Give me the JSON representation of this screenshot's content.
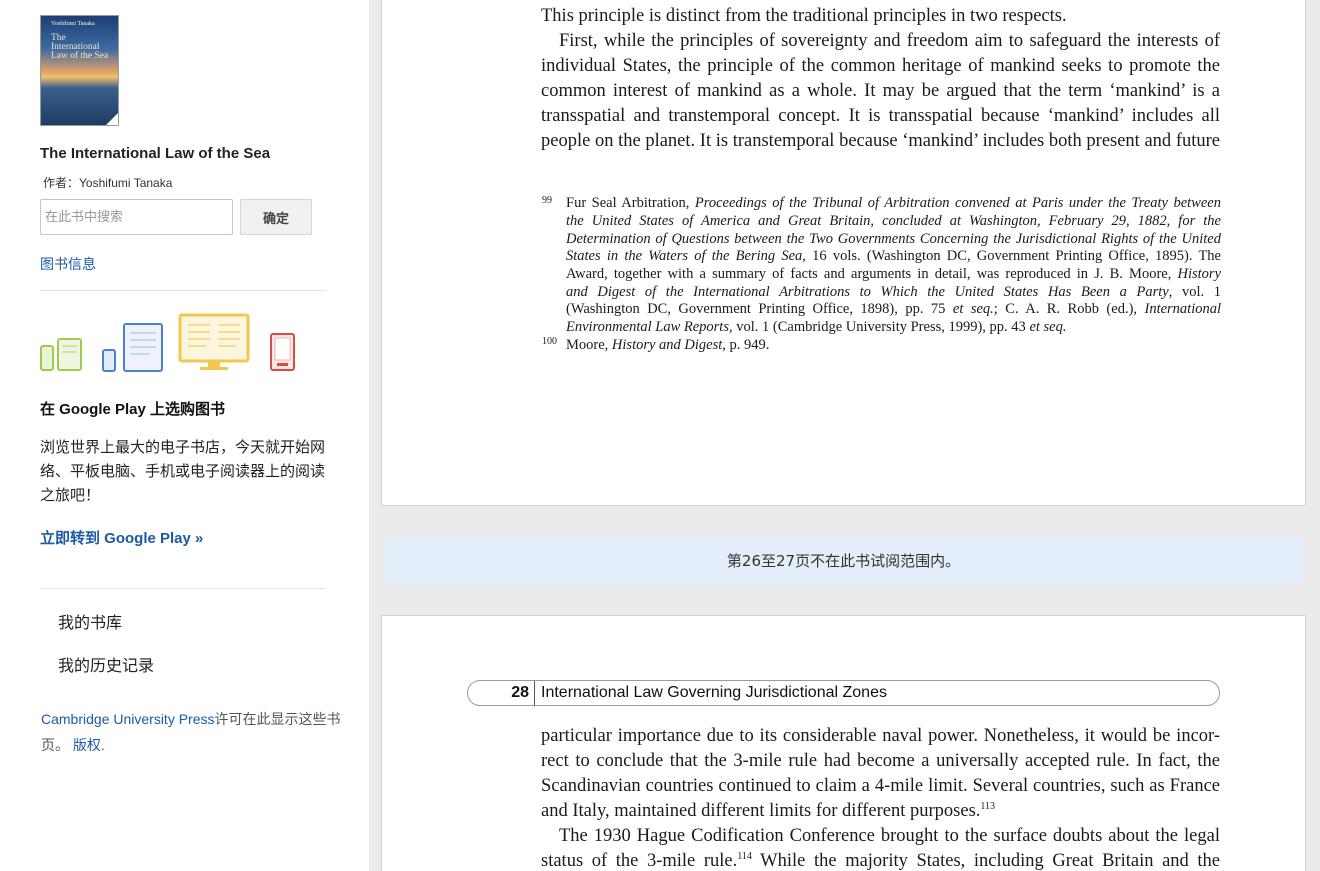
{
  "sidebar": {
    "cover": {
      "author": "Yoshifumi Tanaka",
      "title_lines": [
        "The",
        "International",
        "Law of the Sea"
      ]
    },
    "book_title": "The International Law of the Sea",
    "book_author": "作者：Yoshifumi Tanaka",
    "search": {
      "placeholder": "在此书中搜索",
      "button_label": "确定"
    },
    "book_info_link": "图书信息",
    "google_play": {
      "heading": "在 Google Play 上选购图书",
      "description": "浏览世界上最大的电子书店，今天就开始网络、平板电脑、手机或电子阅读器上的阅读之旅吧！",
      "link": "立即转到 Google Play »"
    },
    "my_library": "我的书库",
    "my_history": "我的历史记录",
    "license": {
      "publisher": "Cambridge University Press",
      "text": "许可在此显示这些书页。",
      "copyright_link": "版权"
    },
    "device_icon_colors": [
      "#9fcb4f",
      "#4a7fd4",
      "#f3c64d",
      "#dc4b42"
    ]
  },
  "viewer": {
    "page1": {
      "lines": [
        "This principle is distinct from the traditional principles in two respects.",
        "First, while the principles of sovereignty and freedom aim to safeguard the interests of",
        "individual States, the principle of the common heritage of mankind seeks to promote the",
        "common interest of mankind as a whole. It may be argued that the term ‘mankind’ is a",
        "transspatial and transtemporal concept. It is transspatial because ‘mankind’ includes all",
        "people on the planet. It is transtemporal because ‘mankind’ includes both present and future"
      ],
      "footnote_99_num": "99",
      "footnote_100_num": "100",
      "footnote_100": {
        "a": "Moore, ",
        "b": "History and Digest",
        "c": ", p. 949."
      }
    },
    "gap_notice": "第26至27页不在此书试阅范围内。",
    "page2": {
      "page_number": "28",
      "running_title": "International Law Governing Jurisdictional Zones",
      "lines": [
        "particular importance due to its considerable naval power. Nonetheless, it would be incor-",
        "rect to conclude that the 3-mile rule had become a universally accepted rule. In fact, the",
        "Scandinavian countries continued to claim a 4-mile limit. Several countries, such as France",
        "and Italy, maintained different limits for different purposes.",
        "The 1930 Hague Codification Conference brought to the surface doubts about the legal",
        "status of the 3-mile rule.",
        " While the majority States, including Great Britain and the"
      ],
      "sup_113": "113",
      "sup_114": "114"
    }
  }
}
